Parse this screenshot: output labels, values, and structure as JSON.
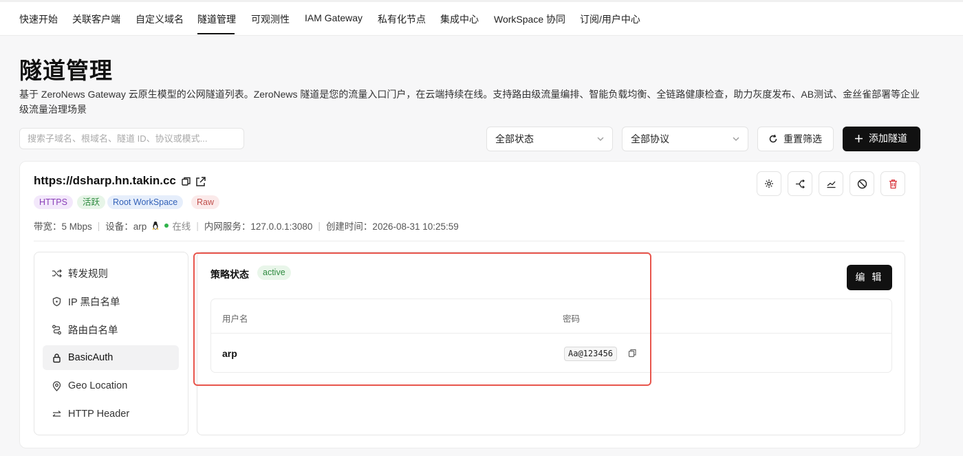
{
  "nav": {
    "items": [
      "快速开始",
      "关联客户端",
      "自定义域名",
      "隧道管理",
      "可观测性",
      "IAM Gateway",
      "私有化节点",
      "集成中心",
      "WorkSpace 协同",
      "订阅/用户中心"
    ],
    "active_index": 3
  },
  "page": {
    "title": "隧道管理",
    "description": "基于 ZeroNews Gateway 云原生模型的公网隧道列表。ZeroNews 隧道是您的流量入口门户，在云端持续在线。支持路由级流量编排、智能负载均衡、全链路健康检查，助力灰度发布、AB测试、金丝雀部署等企业级流量治理场景"
  },
  "filters": {
    "search_placeholder": "搜索子域名、根域名、隧道 ID、协议或模式...",
    "status_select": "全部状态",
    "protocol_select": "全部协议",
    "reset_label": "重置筛选",
    "add_label": "添加隧道"
  },
  "tunnel": {
    "url": "https://dsharp.hn.takin.cc",
    "badges": [
      {
        "text": "HTTPS",
        "bg": "#f3e8fb",
        "fg": "#8a3fb8"
      },
      {
        "text": "活跃",
        "bg": "#e7f5e8",
        "fg": "#2d8a3f"
      },
      {
        "text": "Root WorkSpace",
        "bg": "#e6eefb",
        "fg": "#3361b8"
      },
      {
        "text": "Raw",
        "bg": "#fbeaea",
        "fg": "#c0504d"
      }
    ],
    "meta": {
      "bandwidth": "带宽：5 Mbps",
      "device": "设备：arp",
      "online": "在线",
      "internal": "内网服务：127.0.0.1:3080",
      "created": "创建时间：2026-08-31 10:25:59"
    },
    "actions": [
      "gear-icon",
      "route-icon",
      "chart-icon",
      "ban-icon",
      "trash-icon"
    ]
  },
  "sidebar": {
    "items": [
      {
        "label": "转发规则",
        "icon": "shuffle-icon"
      },
      {
        "label": "IP 黑白名单",
        "icon": "shield-icon"
      },
      {
        "label": "路由白名单",
        "icon": "path-icon"
      },
      {
        "label": "BasicAuth",
        "icon": "lock-icon"
      },
      {
        "label": "Geo Location",
        "icon": "pin-icon"
      },
      {
        "label": "HTTP Header",
        "icon": "arrows-icon"
      }
    ],
    "active_index": 3
  },
  "policy": {
    "label": "策略状态",
    "status": "active",
    "edit_label": "编 辑",
    "table": {
      "headers": [
        "用户名",
        "密码"
      ],
      "rows": [
        {
          "username": "arp",
          "password": "Aa@123456"
        }
      ]
    }
  },
  "colors": {
    "accent": "#111111",
    "highlight": "#e8554c",
    "online": "#2fb34a",
    "danger": "#d9363e"
  }
}
